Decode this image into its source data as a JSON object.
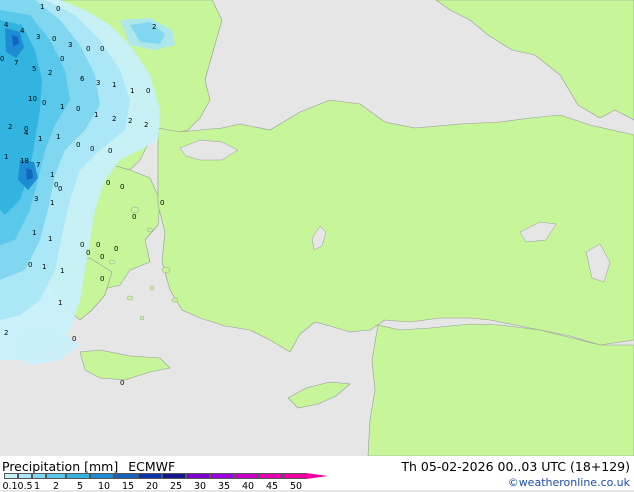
{
  "title": {
    "label": "Precipitation [mm]",
    "model": "ECMWF",
    "datetime": "Th 05-02-2026 00..03 UTC (18+129)",
    "credit": "©weatheronline.co.uk"
  },
  "legend": {
    "ticks": [
      "0.1",
      "0.5",
      "1",
      "2",
      "5",
      "10",
      "15",
      "20",
      "25",
      "30",
      "35",
      "40",
      "45",
      "50"
    ],
    "colors": [
      "#c8f0fa",
      "#aae6f5",
      "#82d7f0",
      "#5ac8eb",
      "#32b4e1",
      "#1e8cd2",
      "#1464be",
      "#0a32aa",
      "#14148c",
      "#8200d2",
      "#a000e6",
      "#c800c8",
      "#e600b4",
      "#f000a0"
    ]
  },
  "map": {
    "land_color": "#c6f59a",
    "sea_color": "#e6e6e6",
    "precip_values": [
      "4",
      "1",
      "0",
      "4",
      "3",
      "0",
      "3",
      "0",
      "0",
      "2",
      "0",
      "7",
      "5",
      "2",
      "0",
      "6",
      "3",
      "1",
      "1",
      "0",
      "10",
      "0",
      "1",
      "0",
      "2",
      "0",
      "1",
      "1",
      "2",
      "2",
      "2",
      "4",
      "1",
      "0",
      "0",
      "0",
      "1",
      "18",
      "7",
      "1",
      "0",
      "0",
      "0",
      "3",
      "1",
      "0",
      "1",
      "1",
      "0",
      "0",
      "0",
      "0",
      "1",
      "1",
      "0",
      "0",
      "1",
      "2",
      "0",
      "0",
      "0",
      "0",
      "0"
    ]
  }
}
